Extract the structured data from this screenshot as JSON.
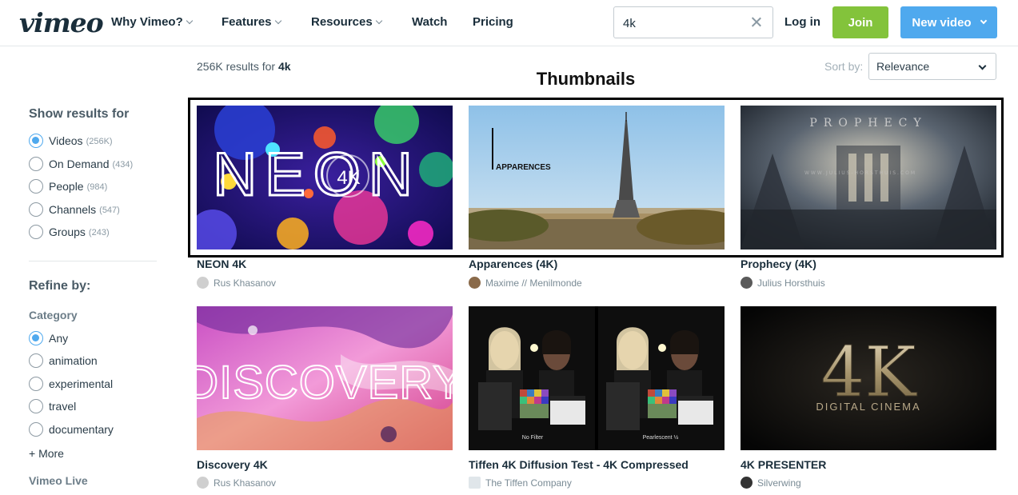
{
  "header": {
    "logo": "vimeo",
    "nav": [
      "Why Vimeo?",
      "Features",
      "Resources",
      "Watch",
      "Pricing"
    ],
    "search_value": "4k",
    "login": "Log in",
    "join": "Join",
    "new_video": "New video"
  },
  "sidebar": {
    "show_results_heading": "Show results for",
    "result_types": [
      {
        "label": "Videos",
        "count": "(256K)",
        "selected": true
      },
      {
        "label": "On Demand",
        "count": "(434)",
        "selected": false
      },
      {
        "label": "People",
        "count": "(984)",
        "selected": false
      },
      {
        "label": "Channels",
        "count": "(547)",
        "selected": false
      },
      {
        "label": "Groups",
        "count": "(243)",
        "selected": false
      }
    ],
    "refine_heading": "Refine by:",
    "category_heading": "Category",
    "categories": [
      {
        "label": "Any",
        "selected": true
      },
      {
        "label": "animation",
        "selected": false
      },
      {
        "label": "experimental",
        "selected": false
      },
      {
        "label": "travel",
        "selected": false
      },
      {
        "label": "documentary",
        "selected": false
      }
    ],
    "more": "+ More",
    "vimeo_live": "Vimeo Live"
  },
  "results": {
    "count_text": "256K results for ",
    "query": "4k",
    "sort_label": "Sort by:",
    "sort_value": "Relevance"
  },
  "annotation": {
    "title": "Thumbnails"
  },
  "videos": [
    {
      "title": "NEON 4K",
      "author": "Rus Khasanov",
      "thumb_text": "NEON",
      "thumb_badge": "4K"
    },
    {
      "title": "Apparences (4K)",
      "author": "Maxime // Menilmonde",
      "thumb_text": "APPARENCES"
    },
    {
      "title": "Prophecy (4K)",
      "author": "Julius Horsthuis",
      "thumb_text": "PROPHECY",
      "thumb_sub": "WWW.JULIUS-HORSTHUIS.COM"
    },
    {
      "title": "Discovery 4K",
      "author": "Rus Khasanov",
      "thumb_text": "DISCOVERY"
    },
    {
      "title": "Tiffen 4K Diffusion Test - 4K Compressed",
      "author": "The Tiffen Company",
      "thumb_left": "No Filter",
      "thumb_right": "Pearlescent ½"
    },
    {
      "title": "4K PRESENTER",
      "author": "Silverwing",
      "thumb_text": "4K",
      "thumb_sub": "DIGITAL CINEMA"
    }
  ],
  "colors": {
    "join": "#83c33b",
    "new_video": "#4fa9ee",
    "radio_selected": "#4fa9ee"
  }
}
